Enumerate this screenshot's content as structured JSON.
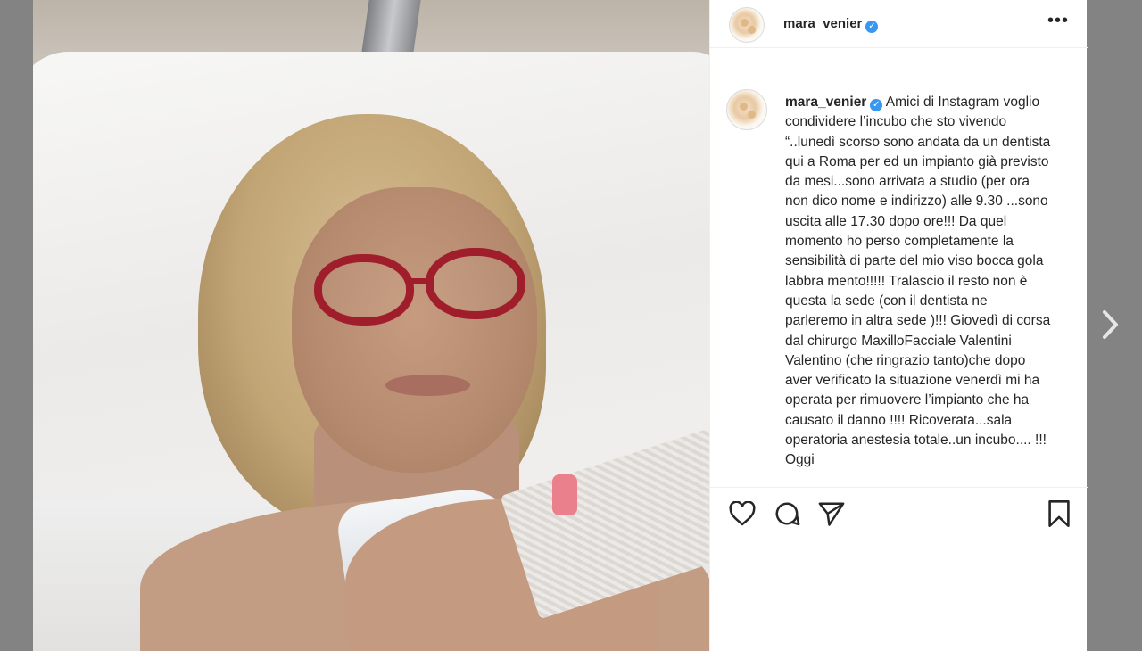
{
  "post": {
    "username": "mara_venier",
    "verified_badge": "✓",
    "more_label": "•••",
    "caption": "Amici di Instagram voglio condividere l’incubo che sto vivendo “..lunedì scorso sono andata da un dentista qui a Roma per ed un impianto già previsto da mesi...sono arrivata a studio (per ora non dico nome e indirizzo) alle 9.30 ...sono uscita alle 17.30 dopo ore!!! Da quel momento ho perso completamente la sensibilità di parte del mio viso bocca gola labbra mento!!!!! Tralascio il resto non è questa la sede (con il dentista ne parleremo in altra sede )!!! Giovedì di corsa dal chirurgo MaxilloFacciale Valentini Valentino (che ringrazio tanto)che dopo aver verificato la situazione venerdì mi ha operata per rimuovere l’impianto che ha causato il danno !!!! Ricoverata...sala operatoria anestesia totale..un incubo.... !!! Oggi"
  },
  "icons": {
    "more": "more-horizontal-icon",
    "like": "heart-icon",
    "comment": "comment-icon",
    "share": "send-icon",
    "save": "bookmark-icon",
    "next": "chevron-right-icon",
    "verified": "verified-badge-icon"
  },
  "colors": {
    "verified": "#3897f0",
    "text": "#262626",
    "overlay": "#838383"
  }
}
